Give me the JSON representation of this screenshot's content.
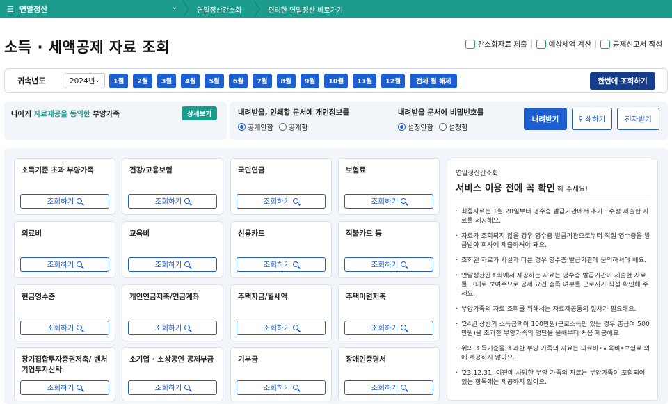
{
  "topbar": {
    "menu_label": "연말정산",
    "crumbs": [
      "연말정산간소화",
      "편리한 연말정산 바로가기"
    ],
    "color": "#1b9c8c"
  },
  "page": {
    "title": "소득 · 세액공제 자료 조회"
  },
  "header_links": [
    {
      "label": "간소화자료 제출",
      "icon": "document-check-icon"
    },
    {
      "label": "예상세액 계산",
      "icon": "calculator-icon"
    },
    {
      "label": "공제신고서 작성",
      "icon": "document-edit-icon"
    }
  ],
  "yearbar": {
    "label": "귀속년도",
    "selected_year": "2024년",
    "months": [
      "1월",
      "2월",
      "3월",
      "4월",
      "5월",
      "6월",
      "7월",
      "8월",
      "9월",
      "10월",
      "11월",
      "12월"
    ],
    "clear_all": "전체 월 해제",
    "query_all": "한번에 조회하기"
  },
  "consent": {
    "prefix": "나에게 ",
    "highlight": "자료제공을 동의한",
    "suffix": " 부양가족",
    "detail_button": "상세보기"
  },
  "options": {
    "privacy": {
      "title": "내려받을, 인쇄할 문서에 개인정보를",
      "choices": [
        "공개안함",
        "공개함"
      ],
      "selected": "공개안함"
    },
    "password": {
      "title": "내려받을 문서에 비밀번호를",
      "choices": [
        "설정안함",
        "설정함"
      ],
      "selected": "설정안함"
    },
    "download": "내려받기",
    "print": "인쇄하기",
    "e_document": "전자받기"
  },
  "cards": [
    {
      "title": "소득기준 초과 부양가족",
      "button": "조회하기"
    },
    {
      "title": "건강/고용보험",
      "button": "조회하기"
    },
    {
      "title": "국민연금",
      "button": "조회하기"
    },
    {
      "title": "보험료",
      "button": "조회하기"
    },
    {
      "title": "의료비",
      "button": "조회하기"
    },
    {
      "title": "교육비",
      "button": "조회하기"
    },
    {
      "title": "신용카드",
      "button": "조회하기"
    },
    {
      "title": "직불카드 등",
      "button": "조회하기"
    },
    {
      "title": "현금영수증",
      "button": "조회하기"
    },
    {
      "title": "개인연금저축/연금계좌",
      "button": "조회하기"
    },
    {
      "title": "주택자금/월세액",
      "button": "조회하기"
    },
    {
      "title": "주택마련저축",
      "button": "조회하기"
    },
    {
      "title": "장기집합투자증권저축/ 벤처기업투자신탁",
      "button": "조회하기"
    },
    {
      "title": "소기업 · 소상공인 공제부금",
      "button": "조회하기"
    },
    {
      "title": "기부금",
      "button": "조회하기"
    },
    {
      "title": "장애인증명서",
      "button": "조회하기"
    }
  ],
  "notice": {
    "subtitle": "연말정산간소화",
    "headline": "서비스 이용 전에 꼭 확인",
    "headline_tail": " 해 주세요!",
    "items": [
      "최종자료는 1월 20일부터 영수증 발급기관에서 추가 · 수정 제출한 자료를 제공해요.",
      "자료가 조회되지 않을 경우 영수증 발급기관으로부터 직접 영수증을 발급받아 회사에 제출하셔야 돼요.",
      "조회된 자료가 사실과 다른 경우 영수증 발급기관에 문의하셔야 해요.",
      "연말정산간소화에서 제공하는 자료는 영수증 발급기관이 제출한 자료를 그대로 보여주므로 공제 요건 충족 여부를 근로자가 직접 확인해 주세요.",
      "부양가족의 자료 조회를 위해서는 자료제공동의 절차가 필요해요.",
      "'24년 상반기 소득금액이 100만원(근로소득만 있는 경우 총급여 500만원)을 초과한 부양가족의 명단을 올해부터 처음 제공해요",
      "위의 소득기준을 초과한 부양 가족의 자료는 의료비•교육비•보험료 외에 제공하지 않아요.",
      "'23.12.31. 이전에 사망한 부양 가족의 자료는 부양가족이 포함되어 있는 항목에는 제공하지 않아요."
    ]
  }
}
